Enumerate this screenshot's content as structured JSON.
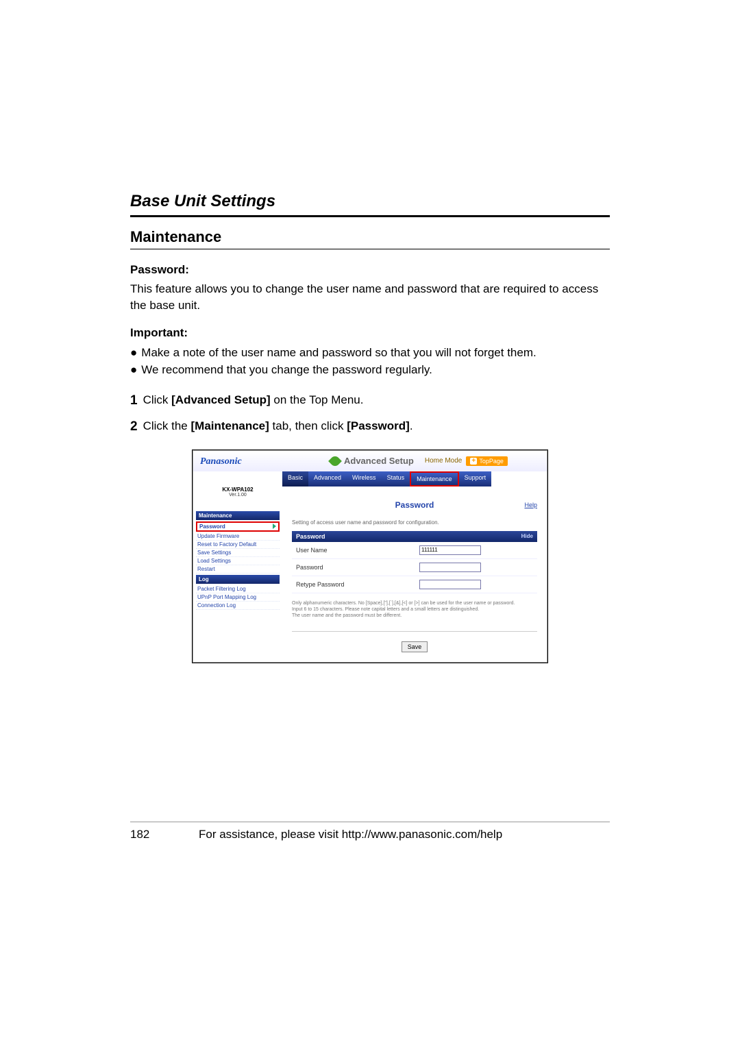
{
  "page": {
    "section_title": "Base Unit Settings",
    "heading": "Maintenance",
    "password_label": "Password:",
    "password_intro": "This feature allows you to change the user name and password that are required to access the base unit.",
    "important_label": "Important:",
    "bullets": [
      "Make a note of the user name and password so that you will not forget them.",
      "We recommend that you change the password regularly."
    ],
    "step1_num": "1",
    "step1_pre": "Click ",
    "step1_bold": "[Advanced Setup]",
    "step1_post": " on the Top Menu.",
    "step2_num": "2",
    "step2_pre": "Click the ",
    "step2_bold1": "[Maintenance]",
    "step2_mid": " tab, then click ",
    "step2_bold2": "[Password]",
    "step2_post": ".",
    "page_number": "182",
    "footer_text": "For assistance, please visit http://www.panasonic.com/help"
  },
  "screenshot": {
    "brand": "Panasonic",
    "model": "KX-WPA102",
    "version": "Ver.1.00",
    "title": "Advanced Setup",
    "home_mode": "Home Mode",
    "top_page": "TopPage",
    "tabs": [
      "Basic",
      "Advanced",
      "Wireless",
      "Status",
      "Maintenance",
      "Support"
    ],
    "sidebar": {
      "maint_header": "Maintenance",
      "items_active": "Password",
      "items": [
        "Update Firmware",
        "Reset to Factory Default",
        "Save Settings",
        "Load Settings",
        "Restart"
      ],
      "log_header": "Log",
      "log_items": [
        "Packet Filtering Log",
        "UPnP Port Mapping Log",
        "Connection Log"
      ]
    },
    "panel": {
      "title": "Password",
      "help": "Help",
      "desc": "Setting of access user name and password for configuration.",
      "bar": "Password",
      "hide": "Hide",
      "username_label": "User Name",
      "username_value": "111111",
      "password_label": "Password",
      "retype_label": "Retype Password",
      "note1": "Only alphanumeric characters. No [Space],[\"],[`],[&],[<] or [>] can be used for the user name or password.",
      "note2": "Input 6 to 15 characters. Please note capital letters and a small letters are distinguished.",
      "note3": "The user name and the password must be different.",
      "save": "Save"
    }
  }
}
